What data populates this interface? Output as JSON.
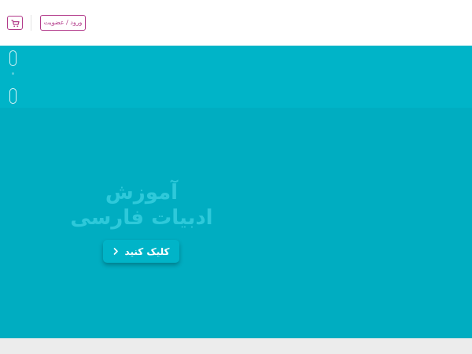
{
  "header": {
    "login_label": "ورود / عضویت",
    "cart_icon": "cart-icon"
  },
  "hero": {
    "title_line1": "آموزش",
    "title_line2": "ادبیات فارسی",
    "cta_label": "کلیک کنید",
    "cta_icon": "chevron-right-icon"
  },
  "colors": {
    "accent": "#b23a8a",
    "band": "#00b4c8",
    "hero_bg": "#00adc1",
    "footer": "#ececec"
  }
}
